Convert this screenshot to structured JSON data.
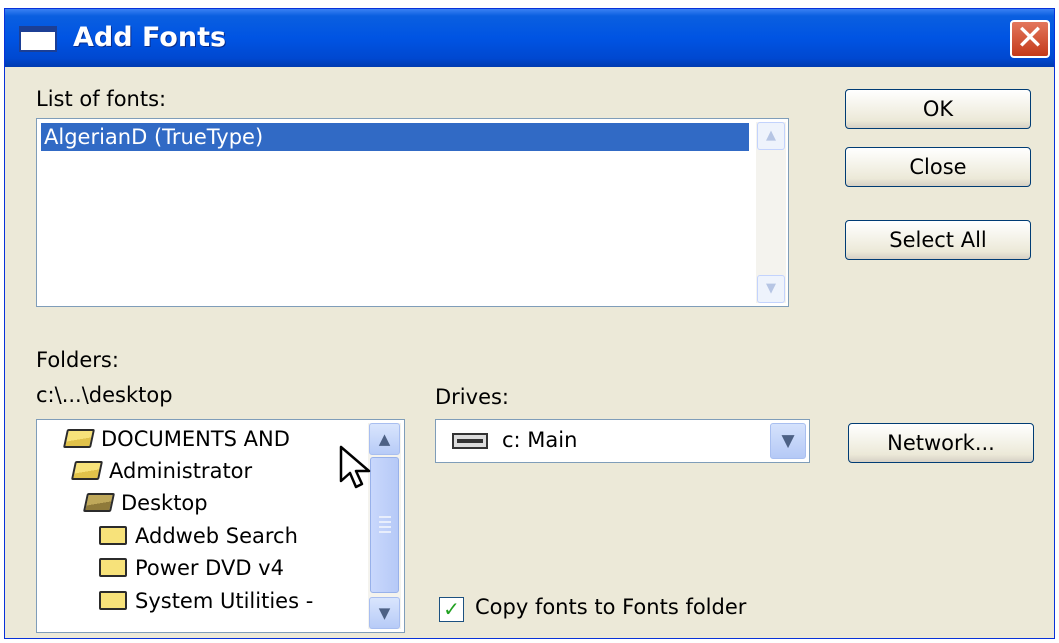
{
  "window": {
    "title": "Add Fonts",
    "close_glyph": "✕"
  },
  "fonts": {
    "label": "List of fonts:",
    "items": [
      "AlgerianD (TrueType)"
    ],
    "selected_index": 0
  },
  "buttons": {
    "ok": "OK",
    "close": "Close",
    "select_all": "Select All",
    "network": "Network..."
  },
  "folders": {
    "label": "Folders:",
    "path": "c:\\...\\desktop",
    "items": [
      {
        "name": "DOCUMENTS AND",
        "icon": "open-folder-icon"
      },
      {
        "name": "Administrator",
        "icon": "open-folder-icon"
      },
      {
        "name": "Desktop",
        "icon": "open-folder-selected-icon"
      },
      {
        "name": "Addweb Search",
        "icon": "folder-icon"
      },
      {
        "name": "Power DVD v4",
        "icon": "folder-icon"
      },
      {
        "name": "System Utilities -",
        "icon": "folder-icon"
      }
    ]
  },
  "drives": {
    "label": "Drives:",
    "selected": "c: Main",
    "icon": "hard-drive-icon"
  },
  "copy_option": {
    "label": "Copy fonts to Fonts folder",
    "checked": true
  },
  "colors": {
    "titlebar": "#0054e3",
    "selection": "#316ac5",
    "dialog_bg": "#ece9d8"
  }
}
